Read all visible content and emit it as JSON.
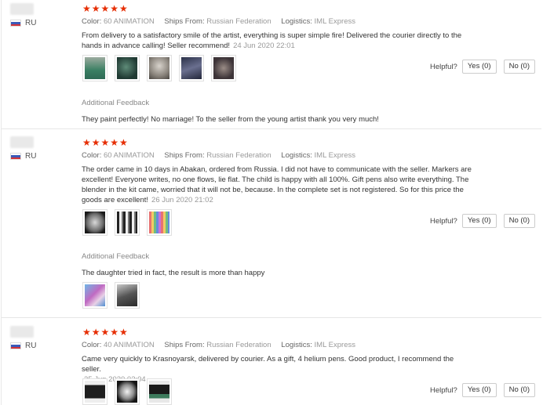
{
  "helpful_label": "Helpful?",
  "additional_feedback_label": "Additional Feedback",
  "labels": {
    "color": "Color:",
    "ships_from": "Ships From:",
    "logistics": "Logistics:"
  },
  "reviews": [
    {
      "country": "RU",
      "stars": "★★★★★",
      "color": "60 ANIMATION",
      "ships_from": "Russian Federation",
      "logistics": "IML Express",
      "text": "From delivery to a satisfactory smile of the artist, everything is super simple fire! Delivered the courier directly to the hands in advance calling! Seller recommend!",
      "date": "24 Jun 2020 22:01",
      "yes": "Yes (0)",
      "no": "No (0)",
      "additional_feedback": "They paint perfectly! No marriage! To the seller from the young artist thank you very much!"
    },
    {
      "country": "RU",
      "stars": "★★★★★",
      "color": "60 ANIMATION",
      "ships_from": "Russian Federation",
      "logistics": "IML Express",
      "text": "The order came in 10 days in Abakan, ordered from Russia. I did not have to communicate with the seller. Markers are excellent! Everyone writes, no one flows, lie flat. The child is happy with all 100%. Gift pens also write everything. The blender in the kit came, worried that it will not be, because. In the complete set is not registered. So for this price the goods are excellent!",
      "date": "26 Jun 2020 21:02",
      "yes": "Yes (0)",
      "no": "No (0)",
      "additional_feedback": "The daughter tried in fact, the result is more than happy"
    },
    {
      "country": "RU",
      "stars": "★★★★★",
      "color": "40 ANIMATION",
      "ships_from": "Russian Federation",
      "logistics": "IML Express",
      "text": "Came very quickly to Krasnoyarsk, delivered by courier. As a gift, 4 helium pens. Good product, I recommend the seller.",
      "date": "25 Jun 2020 02:04",
      "yes": "Yes (0)",
      "no": "No (0)"
    }
  ]
}
